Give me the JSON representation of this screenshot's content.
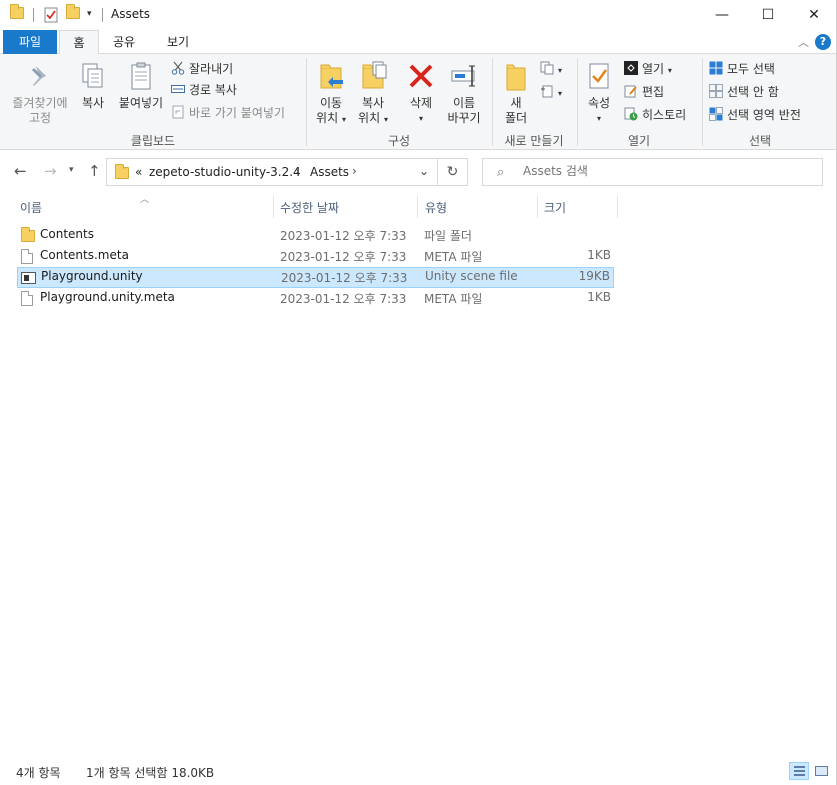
{
  "window": {
    "title": "Assets",
    "minimize_symbol": "—",
    "maximize_symbol": "☐",
    "close_symbol": "✕"
  },
  "ribbon_tabs": {
    "file": "파일",
    "home": "홈",
    "share": "공유",
    "view": "보기"
  },
  "ribbon": {
    "clipboard": {
      "pin_line1": "즐겨찾기에",
      "pin_line2": "고정",
      "copy": "복사",
      "paste": "붙여넣기",
      "cut": "잘라내기",
      "copy_path": "경로 복사",
      "paste_shortcut": "바로 가기 붙여넣기",
      "label": "클립보드"
    },
    "organize": {
      "move_line1": "이동",
      "move_line2": "위치",
      "copy_line1": "복사",
      "copy_line2": "위치",
      "delete": "삭제",
      "rename_line1": "이름",
      "rename_line2": "바꾸기",
      "label": "구성"
    },
    "new": {
      "folder_line1": "새",
      "folder_line2": "폴더",
      "label": "새로 만들기"
    },
    "open": {
      "properties": "속성",
      "open": "열기",
      "edit": "편집",
      "history": "히스토리",
      "label": "열기"
    },
    "select": {
      "select_all": "모두 선택",
      "select_none": "선택 안 함",
      "invert": "선택 영역 반전",
      "label": "선택"
    }
  },
  "address": {
    "overflow": "«",
    "crumbs": [
      "zepeto-studio-unity-3.2.4",
      "Assets"
    ],
    "separator": "›",
    "search_placeholder": "Assets 검색"
  },
  "columns": {
    "name": "이름",
    "date": "수정한 날짜",
    "type": "유형",
    "size": "크기"
  },
  "files": [
    {
      "name": "Contents",
      "date": "2023-01-12 오후 7:33",
      "type": "파일 폴더",
      "size": "",
      "icon": "folder-icon",
      "selected": false
    },
    {
      "name": "Contents.meta",
      "date": "2023-01-12 오후 7:33",
      "type": "META 파일",
      "size": "1KB",
      "icon": "file-icon",
      "selected": false
    },
    {
      "name": "Playground.unity",
      "date": "2023-01-12 오후 7:33",
      "type": "Unity scene file",
      "size": "19KB",
      "icon": "unity-scene-icon",
      "selected": true
    },
    {
      "name": "Playground.unity.meta",
      "date": "2023-01-12 오후 7:33",
      "type": "META 파일",
      "size": "1KB",
      "icon": "file-icon",
      "selected": false
    }
  ],
  "status": {
    "count": "4개 항목",
    "selection": "1개 항목 선택함 18.0KB"
  },
  "colors": {
    "accent": "#1979ca",
    "selection_bg": "#cce8ff",
    "selection_border": "#99d1ff",
    "folder": "#f6d161",
    "delete_red": "#d9241c"
  }
}
